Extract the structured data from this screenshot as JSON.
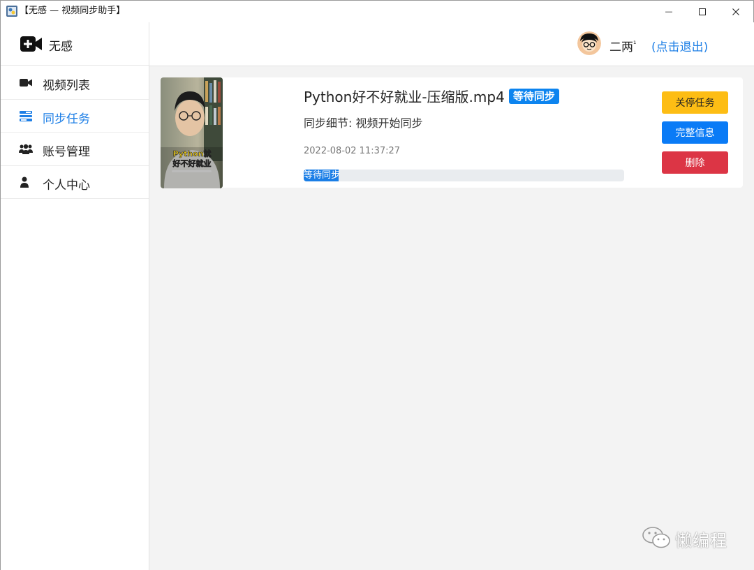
{
  "window": {
    "title": "【无感 — 视频同步助手】",
    "min_glyph": "—",
    "max_glyph": "☐",
    "close_glyph": "✕"
  },
  "brand": {
    "name": "无感",
    "icon": "video-plus-icon"
  },
  "nav": {
    "items": [
      {
        "label": "视频列表",
        "icon": "video-camera-icon",
        "active": false
      },
      {
        "label": "同步任务",
        "icon": "tasks-icon",
        "active": true
      },
      {
        "label": "账号管理",
        "icon": "users-icon",
        "active": false
      },
      {
        "label": "个人中心",
        "icon": "user-icon",
        "active": false
      }
    ]
  },
  "header": {
    "username": "二两",
    "username_sup": "¹",
    "logout": "(点击退出)"
  },
  "task": {
    "title": "Python好不好就业-压缩版.mp4",
    "status_badge": "等待同步",
    "detail": "同步细节: 视频开始同步",
    "timestamp": "2022-08-02 11:37:27",
    "progress_label": "等待同步",
    "progress_fraction": 0.11,
    "thumb_caption_line1": "Python就",
    "thumb_caption_line2": "好不好就业",
    "buttons": {
      "stop": "关停任务",
      "info": "完整信息",
      "delete": "删除"
    }
  },
  "watermark": {
    "text": "懒编程"
  },
  "colors": {
    "accent": "#1e7fe6",
    "warning": "#fdbd14",
    "primary": "#0a7bf6",
    "danger": "#dc3545"
  }
}
